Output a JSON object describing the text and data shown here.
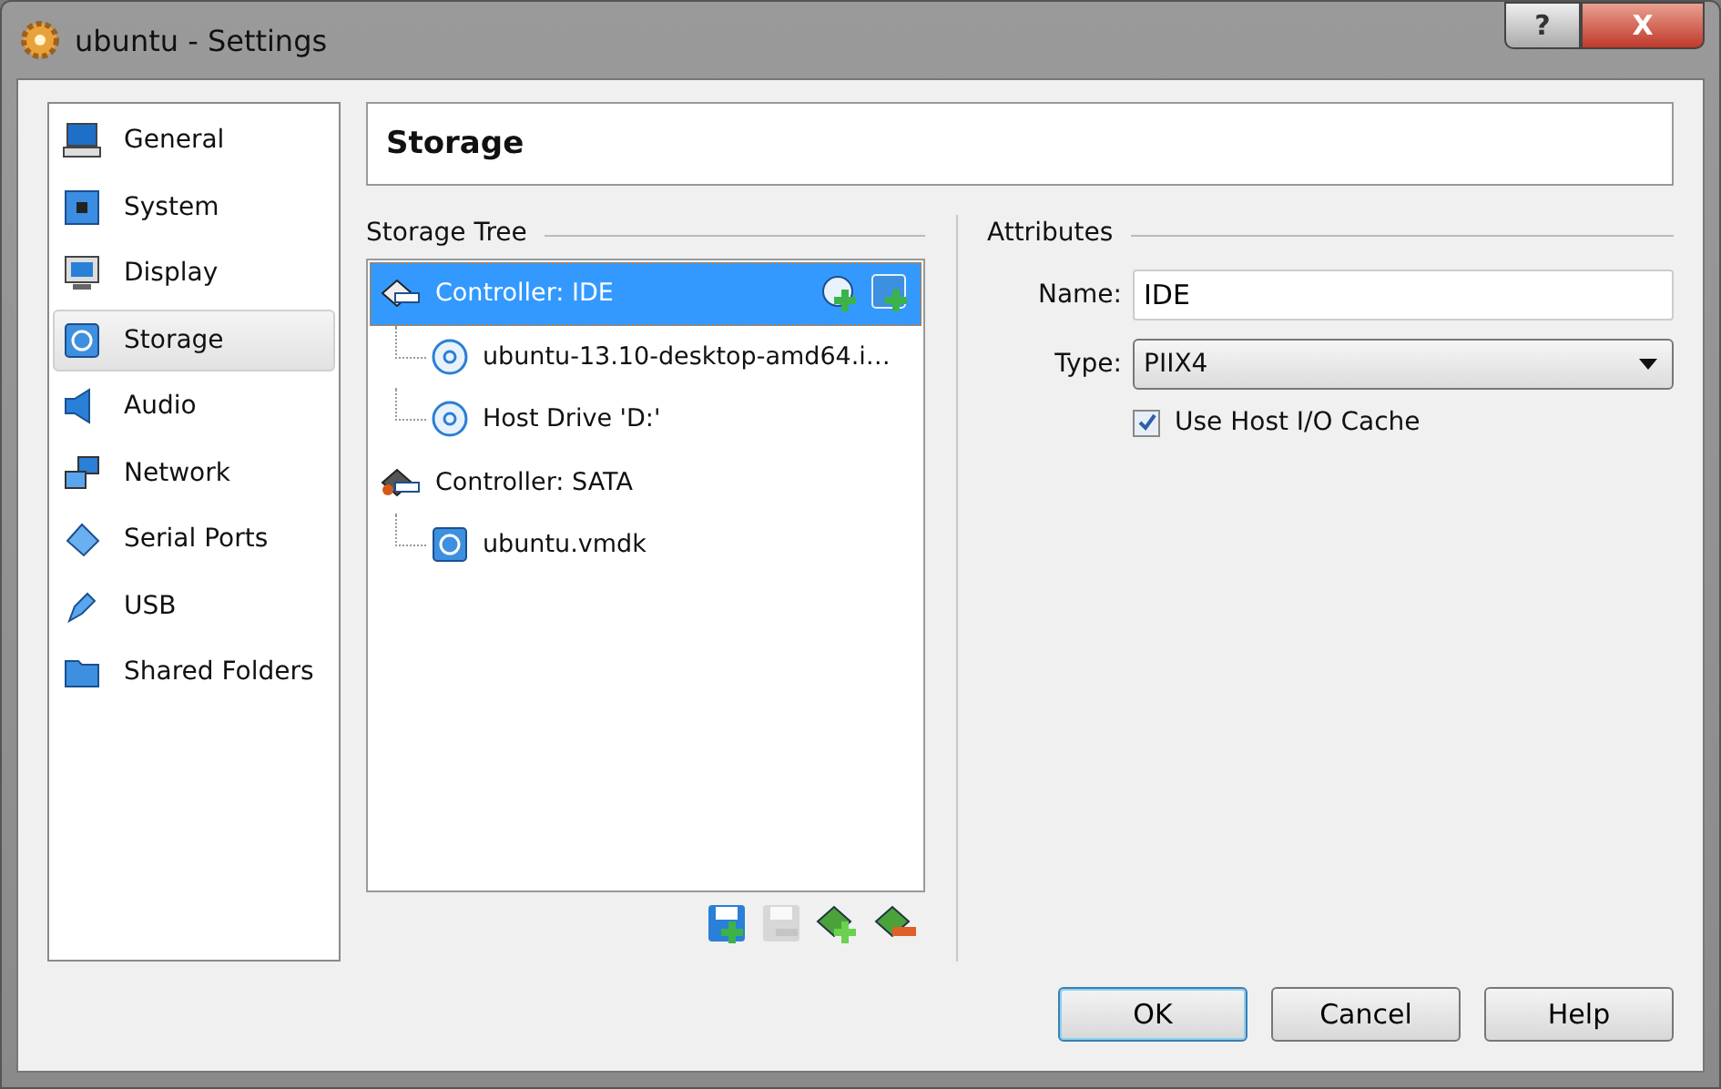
{
  "window": {
    "title": "ubuntu - Settings",
    "help_button": "?",
    "close_button": "X"
  },
  "sidebar": {
    "items": [
      {
        "label": "General",
        "selected": false
      },
      {
        "label": "System",
        "selected": false
      },
      {
        "label": "Display",
        "selected": false
      },
      {
        "label": "Storage",
        "selected": true
      },
      {
        "label": "Audio",
        "selected": false
      },
      {
        "label": "Network",
        "selected": false
      },
      {
        "label": "Serial Ports",
        "selected": false
      },
      {
        "label": "USB",
        "selected": false
      },
      {
        "label": "Shared Folders",
        "selected": false
      }
    ]
  },
  "page_title": "Storage",
  "storage_tree": {
    "label": "Storage Tree",
    "items": [
      {
        "label": "Controller: IDE",
        "kind": "ide",
        "selected": true,
        "children": [
          {
            "label": "ubuntu-13.10-desktop-amd64.i…",
            "kind": "optical",
            "selected": false
          },
          {
            "label": "Host Drive 'D:'",
            "kind": "optical",
            "selected": false
          }
        ]
      },
      {
        "label": "Controller: SATA",
        "kind": "sata",
        "selected": false,
        "children": [
          {
            "label": "ubuntu.vmdk",
            "kind": "disk",
            "selected": false
          }
        ]
      }
    ]
  },
  "tree_toolbar": [
    {
      "kind": "add-disk",
      "disabled": false
    },
    {
      "kind": "remove-disk",
      "disabled": true
    },
    {
      "kind": "add-controller",
      "disabled": false
    },
    {
      "kind": "remove-controller",
      "disabled": false
    }
  ],
  "attributes": {
    "label": "Attributes",
    "name_label": "Name:",
    "name_value": "IDE",
    "type_label": "Type:",
    "type_value": "PIIX4",
    "cache": {
      "label": "Use Host I/O Cache",
      "checked": true
    }
  },
  "buttons": [
    {
      "label": "OK",
      "default": true
    },
    {
      "label": "Cancel",
      "default": false
    },
    {
      "label": "Help",
      "default": false
    }
  ]
}
